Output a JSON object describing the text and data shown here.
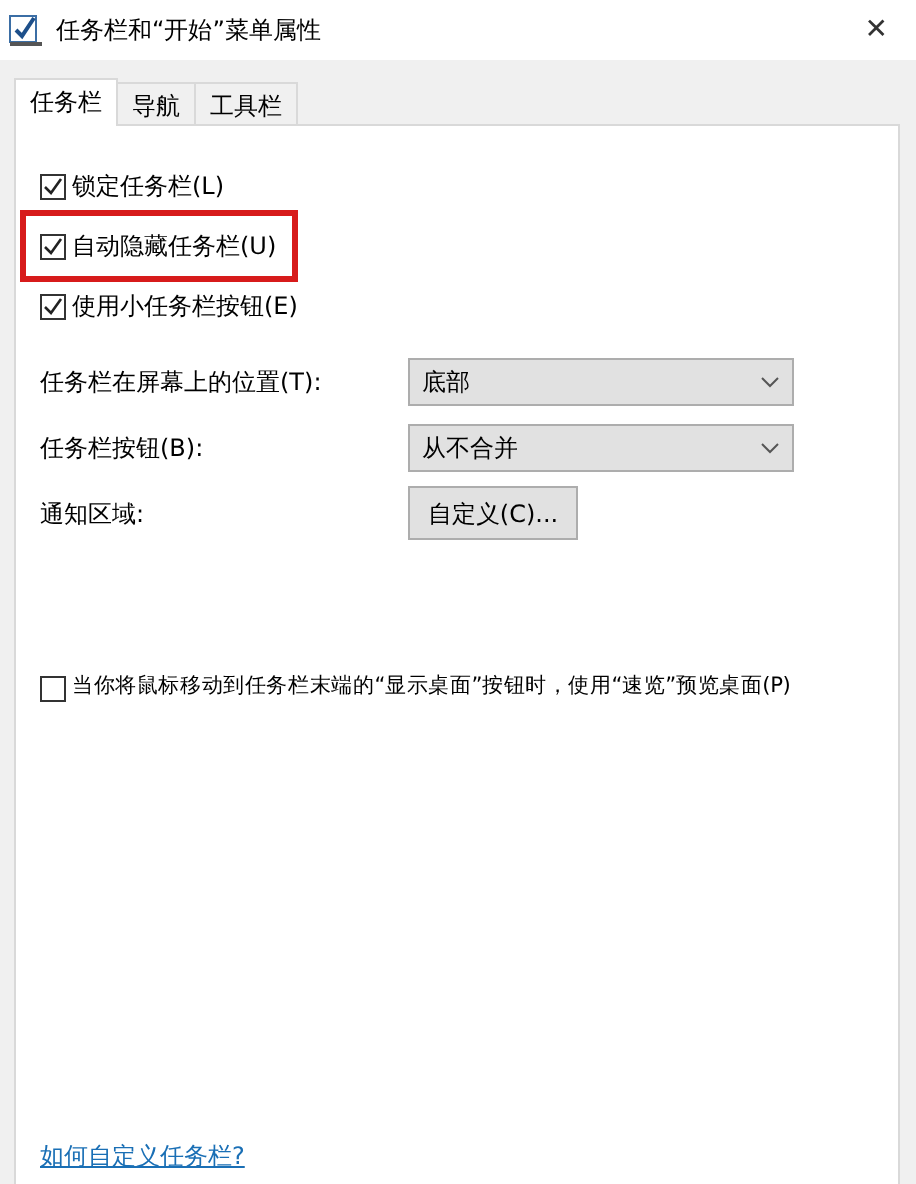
{
  "window": {
    "title": "任务栏和“开始”菜单属性",
    "close": "✕"
  },
  "tabs": [
    {
      "label": "任务栏",
      "selected": true
    },
    {
      "label": "导航",
      "selected": false
    },
    {
      "label": "工具栏",
      "selected": false
    }
  ],
  "checkboxes": [
    {
      "label": "锁定任务栏(L)",
      "checked": true,
      "highlighted": false
    },
    {
      "label": "自动隐藏任务栏(U)",
      "checked": true,
      "highlighted": true
    },
    {
      "label": "使用小任务栏按钮(E)",
      "checked": true,
      "highlighted": false
    }
  ],
  "settings": [
    {
      "kind": "select",
      "label": "任务栏在屏幕上的位置(T):",
      "value": "底部"
    },
    {
      "kind": "select",
      "label": "任务栏按钮(B):",
      "value": "从不合并"
    },
    {
      "kind": "button",
      "label": "通知区域:",
      "value": "自定义(C)..."
    }
  ],
  "peek": {
    "label": "当你将鼠标移动到任务栏末端的“显示桌面”按钮时，使用“速览”预览桌面(P)",
    "checked": false
  },
  "help_link": "如何自定义任务栏?"
}
